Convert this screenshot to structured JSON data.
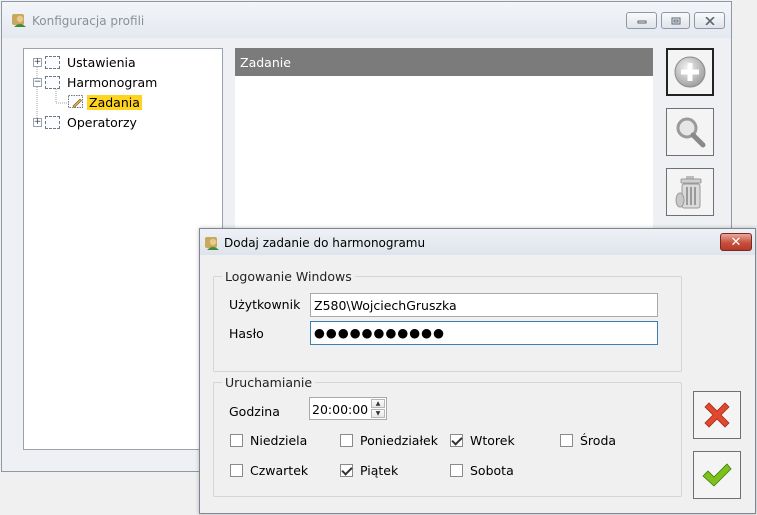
{
  "main_window": {
    "title": "Konfiguracja profili",
    "caption_buttons": {
      "minimize": "▭",
      "maximize": "▣",
      "close": "✕"
    },
    "tree": {
      "items": [
        {
          "label": "Ustawienia",
          "expander": "+",
          "icon": "folder-icon"
        },
        {
          "label": "Harmonogram",
          "expander": "−",
          "icon": "folder-icon"
        },
        {
          "label": "Zadania",
          "icon": "task-icon",
          "selected": true
        },
        {
          "label": "Operatorzy",
          "expander": "+",
          "icon": "folder-icon"
        }
      ]
    },
    "list": {
      "column_header": "Zadanie"
    },
    "side_buttons": [
      {
        "name": "add-button",
        "icon": "plus-circle-icon"
      },
      {
        "name": "view-button",
        "icon": "magnifier-icon"
      },
      {
        "name": "delete-button",
        "icon": "trash-icon"
      }
    ]
  },
  "dialog": {
    "title": "Dodaj zadanie do harmonogramu",
    "close_label": "✕",
    "windows_login": {
      "legend": "Logowanie Windows",
      "user_label": "Użytkownik",
      "user_value": "Z580\\WojciechGruszka",
      "password_label": "Hasło",
      "password_mask": "●●●●●●●●●●●"
    },
    "run": {
      "legend": "Uruchamianie",
      "time_label": "Godzina",
      "time_value": "20:00:00",
      "spin_up": "▲",
      "spin_down": "▼",
      "days": [
        {
          "label": "Niedziela",
          "checked": false
        },
        {
          "label": "Poniedziałek",
          "checked": false
        },
        {
          "label": "Wtorek",
          "checked": true
        },
        {
          "label": "Środa",
          "checked": false
        },
        {
          "label": "Czwartek",
          "checked": false
        },
        {
          "label": "Piątek",
          "checked": true
        },
        {
          "label": "Sobota",
          "checked": false
        }
      ]
    },
    "buttons": [
      {
        "name": "cancel-button",
        "icon": "red-x-icon"
      },
      {
        "name": "ok-button",
        "icon": "green-check-icon"
      }
    ]
  },
  "colors": {
    "selection": "#ffd41f",
    "header_bg": "#7b7b7b",
    "cancel_red": "#e04830",
    "ok_green": "#7cc21a"
  }
}
